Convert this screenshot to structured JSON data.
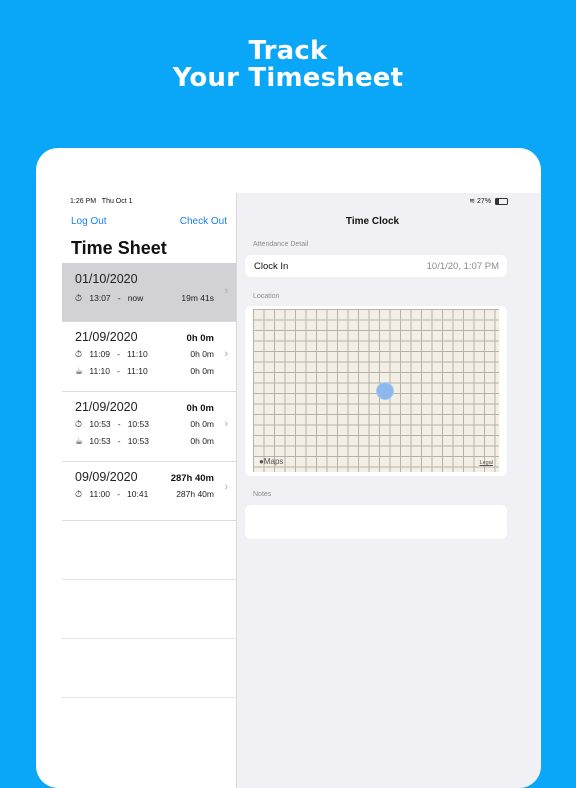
{
  "hero": {
    "line1": "Track",
    "line2": "Your Timesheet"
  },
  "status": {
    "time": "1:26 PM",
    "day": "Thu Oct 1",
    "battery": "27%"
  },
  "left": {
    "logout": "Log Out",
    "checkout": "Check Out",
    "title": "Time Sheet",
    "entries": [
      {
        "date": "01/10/2020",
        "total": "",
        "rows": [
          {
            "icon": "⏱",
            "start": "13:07",
            "dash": "-",
            "end": "now",
            "dur": "19m 41s"
          }
        ]
      },
      {
        "date": "21/09/2020",
        "total": "0h 0m",
        "rows": [
          {
            "icon": "⏱",
            "start": "11:09",
            "dash": "-",
            "end": "11:10",
            "dur": "0h 0m"
          },
          {
            "icon": "☕",
            "start": "11:10",
            "dash": "-",
            "end": "11:10",
            "dur": "0h 0m"
          }
        ]
      },
      {
        "date": "21/09/2020",
        "total": "0h 0m",
        "rows": [
          {
            "icon": "⏱",
            "start": "10:53",
            "dash": "-",
            "end": "10:53",
            "dur": "0h 0m"
          },
          {
            "icon": "☕",
            "start": "10:53",
            "dash": "-",
            "end": "10:53",
            "dur": "0h 0m"
          }
        ]
      },
      {
        "date": "09/09/2020",
        "total": "287h 40m",
        "rows": [
          {
            "icon": "⏱",
            "start": "11:00",
            "dash": "-",
            "end": "10:41",
            "dur": "287h 40m"
          }
        ]
      }
    ]
  },
  "right": {
    "title": "Time Clock",
    "attendance_label": "Attendance Detail",
    "clockin_label": "Clock In",
    "clockin_value": "10/1/20, 1:07 PM",
    "location_label": "Location",
    "maps_label": "Maps",
    "legal_label": "Legal",
    "notes_label": "Notes"
  }
}
